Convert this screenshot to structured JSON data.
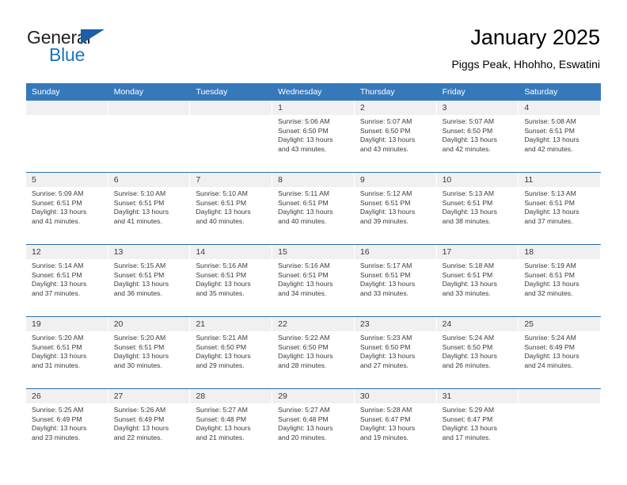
{
  "brand": {
    "word_one": "General",
    "word_two": "Blue",
    "flag_icon": "triangle-flag-icon",
    "accent_color": "#1b75bb"
  },
  "header": {
    "title": "January 2025",
    "subtitle": "Piggs Peak, Hhohho, Eswatini"
  },
  "theme": {
    "header_row_color": "#3679bb",
    "week_divider_color": "#2e6da8",
    "day_band_color": "#f0f0f0"
  },
  "calendar": {
    "weekdays": [
      "Sunday",
      "Monday",
      "Tuesday",
      "Wednesday",
      "Thursday",
      "Friday",
      "Saturday"
    ],
    "weeks": [
      [
        {
          "day": "",
          "lines": []
        },
        {
          "day": "",
          "lines": []
        },
        {
          "day": "",
          "lines": []
        },
        {
          "day": "1",
          "lines": [
            "Sunrise: 5:06 AM",
            "Sunset: 6:50 PM",
            "Daylight: 13 hours",
            "and 43 minutes."
          ]
        },
        {
          "day": "2",
          "lines": [
            "Sunrise: 5:07 AM",
            "Sunset: 6:50 PM",
            "Daylight: 13 hours",
            "and 43 minutes."
          ]
        },
        {
          "day": "3",
          "lines": [
            "Sunrise: 5:07 AM",
            "Sunset: 6:50 PM",
            "Daylight: 13 hours",
            "and 42 minutes."
          ]
        },
        {
          "day": "4",
          "lines": [
            "Sunrise: 5:08 AM",
            "Sunset: 6:51 PM",
            "Daylight: 13 hours",
            "and 42 minutes."
          ]
        }
      ],
      [
        {
          "day": "5",
          "lines": [
            "Sunrise: 5:09 AM",
            "Sunset: 6:51 PM",
            "Daylight: 13 hours",
            "and 41 minutes."
          ]
        },
        {
          "day": "6",
          "lines": [
            "Sunrise: 5:10 AM",
            "Sunset: 6:51 PM",
            "Daylight: 13 hours",
            "and 41 minutes."
          ]
        },
        {
          "day": "7",
          "lines": [
            "Sunrise: 5:10 AM",
            "Sunset: 6:51 PM",
            "Daylight: 13 hours",
            "and 40 minutes."
          ]
        },
        {
          "day": "8",
          "lines": [
            "Sunrise: 5:11 AM",
            "Sunset: 6:51 PM",
            "Daylight: 13 hours",
            "and 40 minutes."
          ]
        },
        {
          "day": "9",
          "lines": [
            "Sunrise: 5:12 AM",
            "Sunset: 6:51 PM",
            "Daylight: 13 hours",
            "and 39 minutes."
          ]
        },
        {
          "day": "10",
          "lines": [
            "Sunrise: 5:13 AM",
            "Sunset: 6:51 PM",
            "Daylight: 13 hours",
            "and 38 minutes."
          ]
        },
        {
          "day": "11",
          "lines": [
            "Sunrise: 5:13 AM",
            "Sunset: 6:51 PM",
            "Daylight: 13 hours",
            "and 37 minutes."
          ]
        }
      ],
      [
        {
          "day": "12",
          "lines": [
            "Sunrise: 5:14 AM",
            "Sunset: 6:51 PM",
            "Daylight: 13 hours",
            "and 37 minutes."
          ]
        },
        {
          "day": "13",
          "lines": [
            "Sunrise: 5:15 AM",
            "Sunset: 6:51 PM",
            "Daylight: 13 hours",
            "and 36 minutes."
          ]
        },
        {
          "day": "14",
          "lines": [
            "Sunrise: 5:16 AM",
            "Sunset: 6:51 PM",
            "Daylight: 13 hours",
            "and 35 minutes."
          ]
        },
        {
          "day": "15",
          "lines": [
            "Sunrise: 5:16 AM",
            "Sunset: 6:51 PM",
            "Daylight: 13 hours",
            "and 34 minutes."
          ]
        },
        {
          "day": "16",
          "lines": [
            "Sunrise: 5:17 AM",
            "Sunset: 6:51 PM",
            "Daylight: 13 hours",
            "and 33 minutes."
          ]
        },
        {
          "day": "17",
          "lines": [
            "Sunrise: 5:18 AM",
            "Sunset: 6:51 PM",
            "Daylight: 13 hours",
            "and 33 minutes."
          ]
        },
        {
          "day": "18",
          "lines": [
            "Sunrise: 5:19 AM",
            "Sunset: 6:51 PM",
            "Daylight: 13 hours",
            "and 32 minutes."
          ]
        }
      ],
      [
        {
          "day": "19",
          "lines": [
            "Sunrise: 5:20 AM",
            "Sunset: 6:51 PM",
            "Daylight: 13 hours",
            "and 31 minutes."
          ]
        },
        {
          "day": "20",
          "lines": [
            "Sunrise: 5:20 AM",
            "Sunset: 6:51 PM",
            "Daylight: 13 hours",
            "and 30 minutes."
          ]
        },
        {
          "day": "21",
          "lines": [
            "Sunrise: 5:21 AM",
            "Sunset: 6:50 PM",
            "Daylight: 13 hours",
            "and 29 minutes."
          ]
        },
        {
          "day": "22",
          "lines": [
            "Sunrise: 5:22 AM",
            "Sunset: 6:50 PM",
            "Daylight: 13 hours",
            "and 28 minutes."
          ]
        },
        {
          "day": "23",
          "lines": [
            "Sunrise: 5:23 AM",
            "Sunset: 6:50 PM",
            "Daylight: 13 hours",
            "and 27 minutes."
          ]
        },
        {
          "day": "24",
          "lines": [
            "Sunrise: 5:24 AM",
            "Sunset: 6:50 PM",
            "Daylight: 13 hours",
            "and 26 minutes."
          ]
        },
        {
          "day": "25",
          "lines": [
            "Sunrise: 5:24 AM",
            "Sunset: 6:49 PM",
            "Daylight: 13 hours",
            "and 24 minutes."
          ]
        }
      ],
      [
        {
          "day": "26",
          "lines": [
            "Sunrise: 5:25 AM",
            "Sunset: 6:49 PM",
            "Daylight: 13 hours",
            "and 23 minutes."
          ]
        },
        {
          "day": "27",
          "lines": [
            "Sunrise: 5:26 AM",
            "Sunset: 6:49 PM",
            "Daylight: 13 hours",
            "and 22 minutes."
          ]
        },
        {
          "day": "28",
          "lines": [
            "Sunrise: 5:27 AM",
            "Sunset: 6:48 PM",
            "Daylight: 13 hours",
            "and 21 minutes."
          ]
        },
        {
          "day": "29",
          "lines": [
            "Sunrise: 5:27 AM",
            "Sunset: 6:48 PM",
            "Daylight: 13 hours",
            "and 20 minutes."
          ]
        },
        {
          "day": "30",
          "lines": [
            "Sunrise: 5:28 AM",
            "Sunset: 6:47 PM",
            "Daylight: 13 hours",
            "and 19 minutes."
          ]
        },
        {
          "day": "31",
          "lines": [
            "Sunrise: 5:29 AM",
            "Sunset: 6:47 PM",
            "Daylight: 13 hours",
            "and 17 minutes."
          ]
        },
        {
          "day": "",
          "lines": []
        }
      ]
    ]
  }
}
